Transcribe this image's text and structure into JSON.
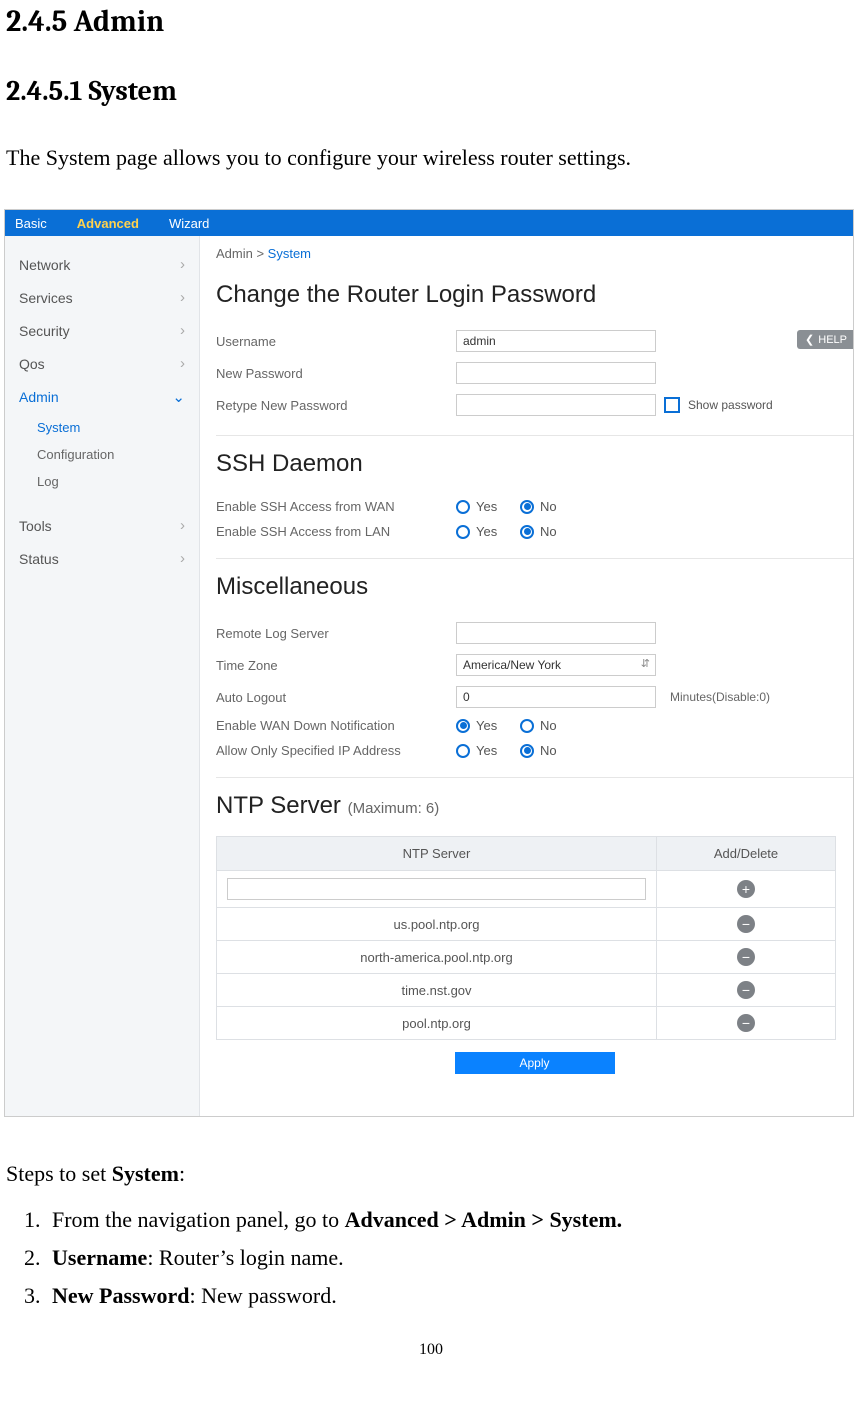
{
  "doc": {
    "heading": "2.4.5 Admin",
    "subheading": "2.4.5.1 System",
    "intro": "The System page allows you to configure your wireless router settings.",
    "steps_intro_pre": "Steps to set ",
    "steps_intro_bold": "System",
    "steps_intro_post": ":",
    "steps": [
      {
        "pre": "From the navigation panel, go to ",
        "bold": "Advanced > Admin > System.",
        "post": ""
      },
      {
        "pre": "",
        "bold": "Username",
        "post": ": Router’s login name."
      },
      {
        "pre": "",
        "bold": "New Password",
        "post": ": New password."
      }
    ],
    "page_number": "100"
  },
  "shot": {
    "top_tabs": {
      "basic": "Basic",
      "advanced": "Advanced",
      "wizard": "Wizard"
    },
    "breadcrumb": {
      "parent": "Admin > ",
      "current": "System"
    },
    "help": "HELP",
    "sidebar": {
      "items": [
        "Network",
        "Services",
        "Security",
        "Qos",
        "Admin",
        "Tools",
        "Status"
      ],
      "admin_sub": [
        "System",
        "Configuration",
        "Log"
      ]
    },
    "sec1": {
      "title": "Change the Router Login Password",
      "username_label": "Username",
      "username_value": "admin",
      "newpass_label": "New Password",
      "retype_label": "Retype New Password",
      "show_pw": "Show password"
    },
    "sec2": {
      "title": "SSH Daemon",
      "wan_label": "Enable SSH Access from WAN",
      "lan_label": "Enable SSH Access from LAN",
      "yes": "Yes",
      "no": "No"
    },
    "sec3": {
      "title": "Miscellaneous",
      "log_label": "Remote Log Server",
      "tz_label": "Time Zone",
      "tz_value": "America/New York",
      "auto_label": "Auto Logout",
      "auto_value": "0",
      "auto_note": "Minutes(Disable:0)",
      "wan_down_label": "Enable WAN Down Notification",
      "ip_label": "Allow Only Specified IP Address",
      "yes": "Yes",
      "no": "No"
    },
    "sec4": {
      "title": "NTP Server ",
      "title_sub": "(Maximum: 6)",
      "th_server": "NTP Server",
      "th_action": "Add/Delete",
      "rows": [
        "us.pool.ntp.org",
        "north-america.pool.ntp.org",
        "time.nst.gov",
        "pool.ntp.org"
      ],
      "apply": "Apply"
    }
  }
}
